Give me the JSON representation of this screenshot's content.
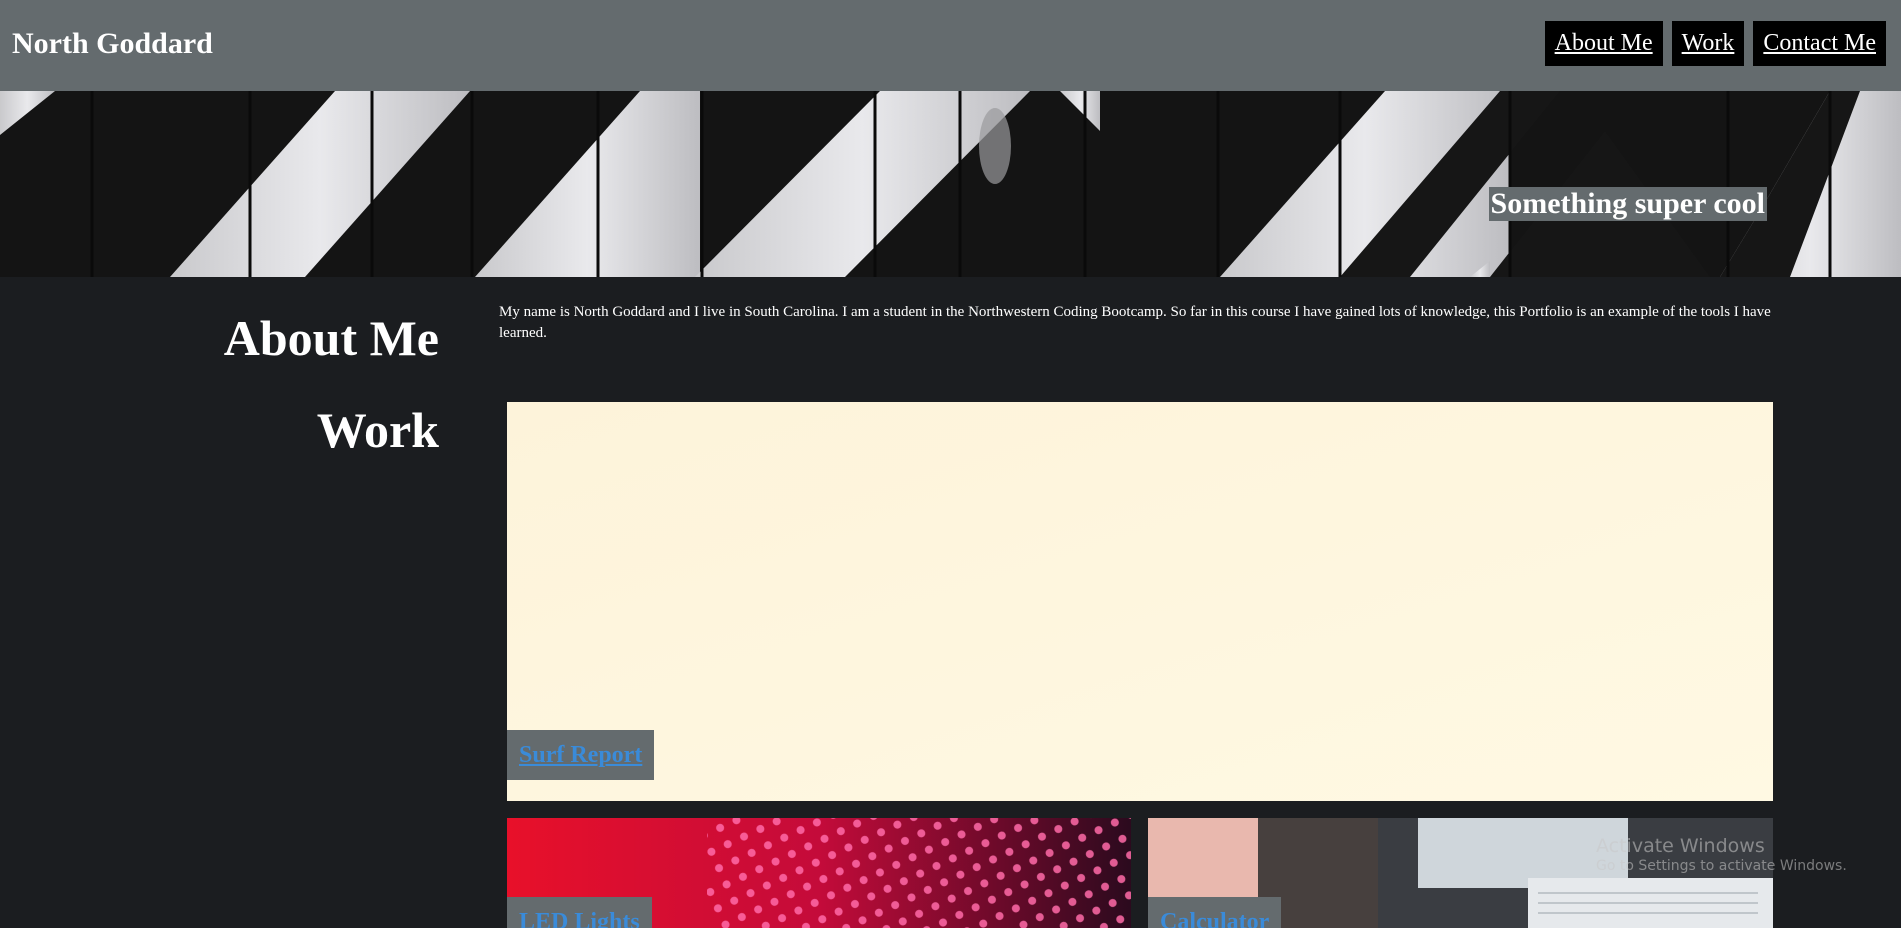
{
  "header": {
    "site_title": "North Goddard",
    "nav": [
      {
        "label": "About Me"
      },
      {
        "label": "Work"
      },
      {
        "label": "Contact Me"
      }
    ]
  },
  "hero": {
    "tagline": "Something super cool"
  },
  "about": {
    "heading": "About Me",
    "text": "My name is North Goddard and I live in South Carolina. I am a student in the Northwestern Coding Bootcamp. So far in this course I have gained lots of knowledge, this Portfolio is an example of the tools I have learned."
  },
  "work": {
    "heading": "Work",
    "projects": [
      {
        "title": "Surf Report"
      },
      {
        "title": "LED Lights"
      },
      {
        "title": "Calculator"
      }
    ]
  },
  "system_watermark": {
    "line1": "Activate Windows",
    "line2": "Go to Settings to activate Windows."
  },
  "colors": {
    "header_bg": "#646b6e",
    "page_bg": "#1b1d20",
    "nav_bg": "#000000",
    "link": "#3a8bd9"
  }
}
